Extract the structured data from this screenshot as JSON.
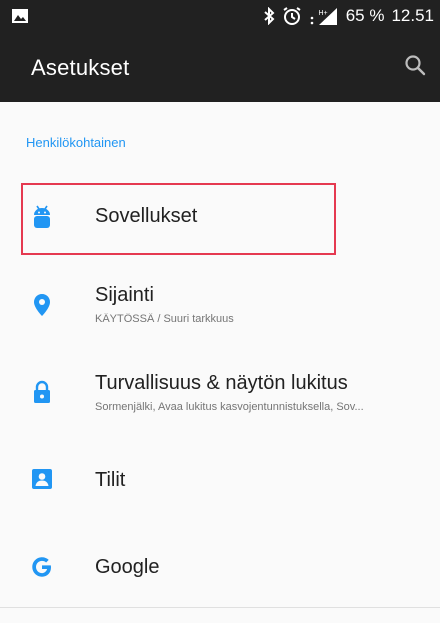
{
  "status_bar": {
    "battery": "65 %",
    "time": "12.51",
    "icons": [
      "image-icon",
      "bluetooth-icon",
      "alarm-icon",
      "signal-icon"
    ]
  },
  "app_bar": {
    "title": "Asetukset",
    "search_icon": "search-icon"
  },
  "section": {
    "header": "Henkilökohtainen"
  },
  "items": [
    {
      "title": "Sovellukset",
      "summary": "",
      "icon": "android-icon",
      "highlighted": true
    },
    {
      "title": "Sijainti",
      "summary": "KÄYTÖSSÄ / Suuri tarkkuus",
      "icon": "location-pin-icon"
    },
    {
      "title": "Turvallisuus & näytön lukitus",
      "summary": "Sormenjälki, Avaa lukitus kasvojentunnistuksella, Sov...",
      "icon": "lock-icon"
    },
    {
      "title": "Tilit",
      "summary": "",
      "icon": "account-box-icon"
    },
    {
      "title": "Google",
      "summary": "",
      "icon": "google-icon"
    }
  ],
  "colors": {
    "accent": "#2196f3",
    "bar": "#212121",
    "highlight": "#e53950"
  }
}
